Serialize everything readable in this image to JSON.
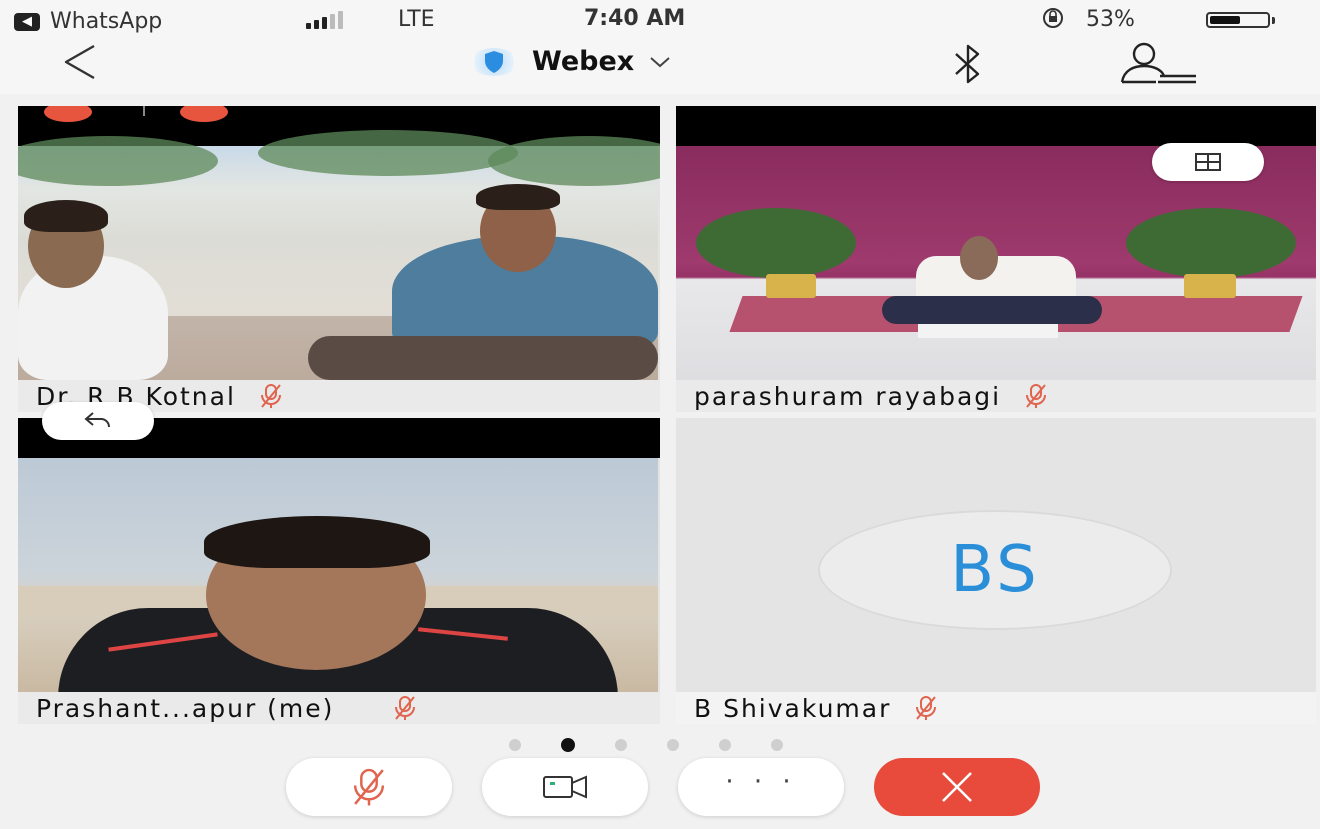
{
  "status_bar": {
    "back_app": "WhatsApp",
    "network": "LTE",
    "time": "7:40 AM",
    "battery_percent": "53%",
    "battery_level": 0.53
  },
  "header": {
    "title": "Webex"
  },
  "participants": [
    {
      "name": "Dr. R B Kotnal",
      "muted": true
    },
    {
      "name": "parashuram rayabagi",
      "muted": true
    },
    {
      "name": "Prashant...apur  (me)",
      "muted": true
    },
    {
      "name": "B Shivakumar",
      "muted": true,
      "initials": "BS"
    }
  ],
  "pager": {
    "total": 6,
    "active_index": 1
  },
  "colors": {
    "accent": "#2a8fd8",
    "end_call": "#e84a3b",
    "mute_red": "#e0644e"
  },
  "icons": {
    "back": "chevron-left-icon",
    "secure": "shield-icon",
    "bluetooth": "bluetooth-icon",
    "participants": "participants-icon",
    "layout": "grid-layout-icon",
    "share_back": "return-arrow-icon",
    "mute": "mic-muted-icon",
    "video": "video-camera-icon",
    "more": "more-icon",
    "end": "close-icon"
  }
}
